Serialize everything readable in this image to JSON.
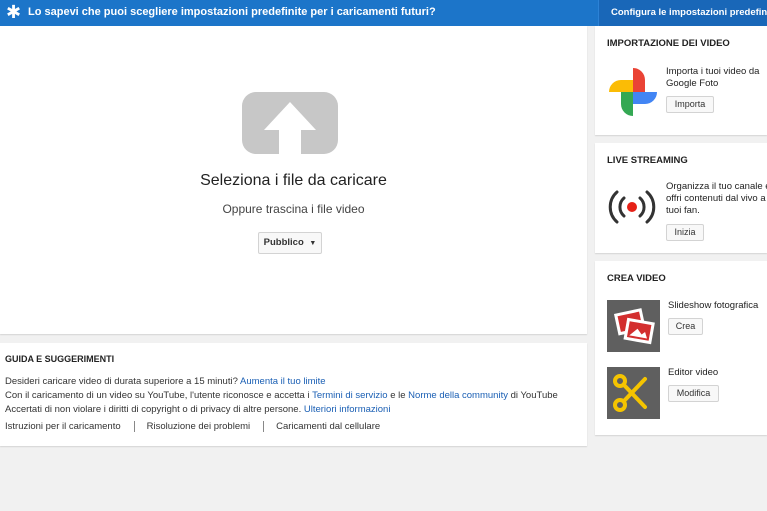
{
  "banner": {
    "message": "Lo sapevi che puoi scegliere impostazioni predefinite per i caricamenti futuri?",
    "config_label": "Configura le impostazioni predefinite"
  },
  "upload": {
    "title": "Seleziona i file da caricare",
    "subtitle": "Oppure trascina i file video",
    "privacy_selected": "Pubblico"
  },
  "guide": {
    "heading": "GUIDA E SUGGERIMENTI",
    "line1_text": "Desideri caricare video di durata superiore a 15 minuti?",
    "line1_link": "Aumenta il tuo limite",
    "line2_a": "Con il caricamento di un video su YouTube, l'utente riconosce e accetta i",
    "line2_link1": "Termini di servizio",
    "line2_b": "e le",
    "line2_link2": "Norme della community",
    "line2_c": "di YouTube",
    "line3_text": "Accertati di non violare i diritti di copyright o di privacy di altre persone.",
    "line3_link": "Ulteriori informazioni",
    "links": [
      "Istruzioni per il caricamento",
      "Risoluzione dei problemi",
      "Caricamenti dal cellulare"
    ]
  },
  "import": {
    "heading": "IMPORTAZIONE DEI VIDEO",
    "text_line1": "Importa i tuoi video da",
    "text_line2": "Google Foto",
    "button": "Importa"
  },
  "live": {
    "heading": "LIVE STREAMING",
    "text_line1": "Organizza il tuo canale e",
    "text_line2": "offri contenuti dal vivo a",
    "text_line3": "tuoi fan.",
    "button": "Inizia"
  },
  "create": {
    "heading": "CREA VIDEO",
    "slideshow_label": "Slideshow fotografica",
    "slideshow_button": "Crea",
    "editor_label": "Editor video",
    "editor_button": "Modifica"
  },
  "colors": {
    "banner": "#1c75c9",
    "link": "#1a5fb4",
    "upload_icon": "#c7c7c7",
    "live_dot": "#e62117"
  }
}
